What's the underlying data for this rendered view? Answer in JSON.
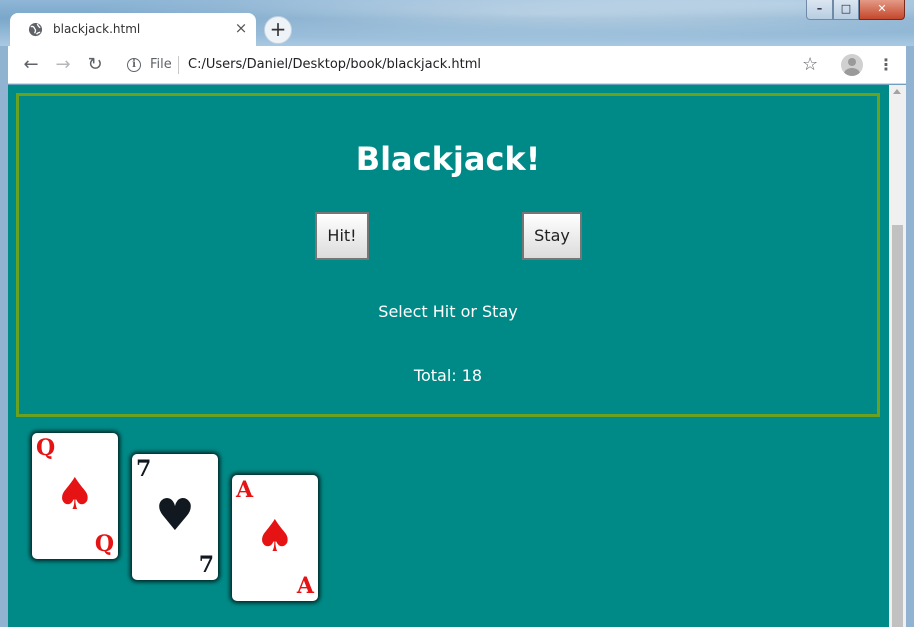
{
  "browser": {
    "tab_title": "blackjack.html",
    "tab_close": "×",
    "new_tab": "+",
    "file_label": "File",
    "url": "C:/Users/Daniel/Desktop/book/blackjack.html",
    "icons": {
      "back": "←",
      "forward": "→",
      "reload": "↻",
      "info": "i",
      "star": "☆",
      "menu": "⋮",
      "minimize": "–",
      "maximize": "□",
      "close": "✕"
    }
  },
  "game": {
    "title": "Blackjack!",
    "hit_label": "Hit!",
    "stay_label": "Stay",
    "status": "Select Hit or Stay",
    "total": "Total: 18",
    "panel_border_color": "#6aa121",
    "background_color": "#008a87"
  },
  "cards": [
    {
      "rank": "Q",
      "suit": "♠",
      "color": "red"
    },
    {
      "rank": "7",
      "suit": "♥",
      "color": "black"
    },
    {
      "rank": "A",
      "suit": "♠",
      "color": "red"
    }
  ]
}
